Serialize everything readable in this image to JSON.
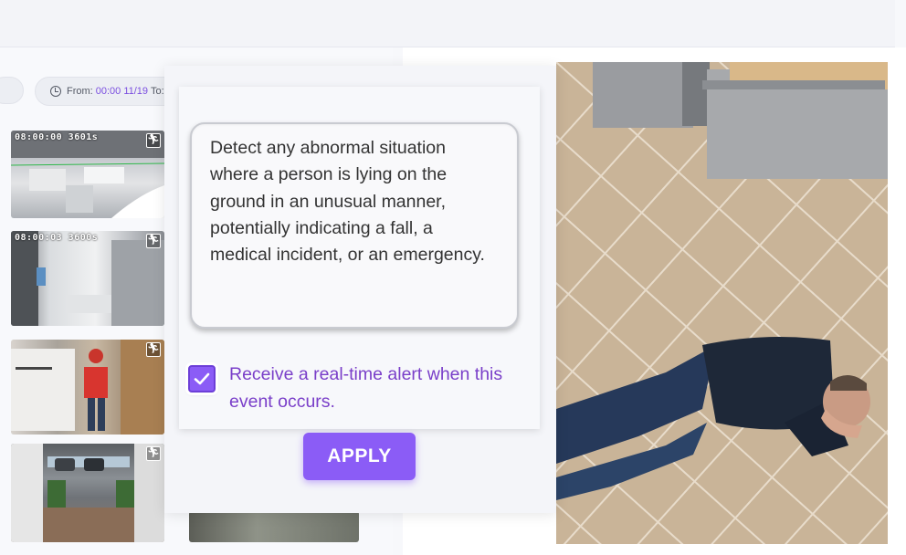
{
  "toolbar": {
    "from_label": "From:",
    "from_value": "00:00 11/19",
    "to_label": "To:"
  },
  "thumbnails": [
    {
      "timestamp": "08:00:00 3601s"
    },
    {
      "timestamp": "08:00:03 3600s"
    },
    {
      "timestamp": ""
    },
    {
      "timestamp": ""
    }
  ],
  "modal": {
    "description": "Detect any abnormal situation where a person is lying on the ground in an unusual manner, potentially indicating a fall, a medical incident, or an emergency.",
    "alert_label": "Receive a real-time alert when this event occurs.",
    "alert_checked": true,
    "apply_label": "APPLY"
  },
  "colors": {
    "accent": "#8b5cf6",
    "label_purple": "#7a3fc9"
  },
  "icons": {
    "clock": "clock-icon",
    "running_person": "running-person-icon",
    "check": "check-icon"
  }
}
